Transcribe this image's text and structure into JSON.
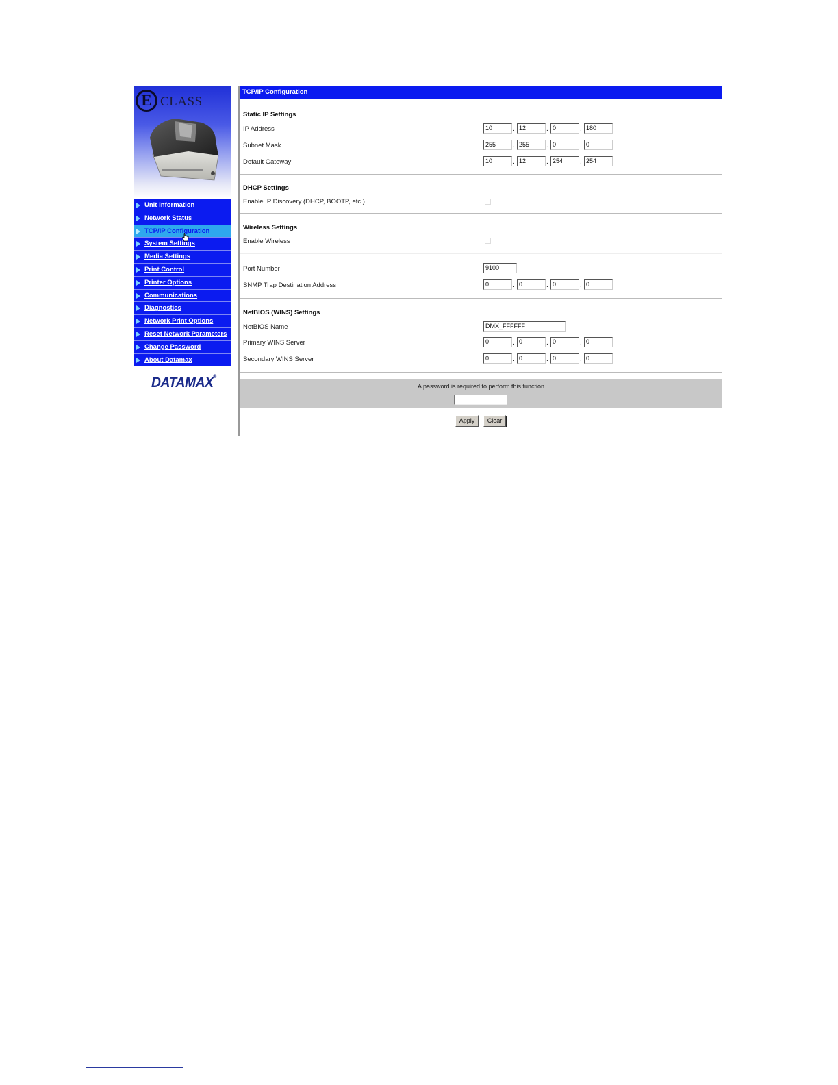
{
  "sidebar": {
    "logo_letter": "E",
    "logo_text": "CLASS",
    "menu": [
      {
        "label": "Unit Information",
        "active": false
      },
      {
        "label": "Network Status",
        "active": false
      },
      {
        "label": "TCP/IP Configuration",
        "active": true
      },
      {
        "label": "System Settings",
        "active": false
      },
      {
        "label": "Media Settings",
        "active": false
      },
      {
        "label": "Print Control",
        "active": false
      },
      {
        "label": "Printer Options",
        "active": false
      },
      {
        "label": "Communications",
        "active": false
      },
      {
        "label": "Diagnostics",
        "active": false
      },
      {
        "label": "Network Print Options",
        "active": false
      },
      {
        "label": "Reset Network Parameters",
        "active": false
      },
      {
        "label": "Change Password",
        "active": false
      },
      {
        "label": "About Datamax",
        "active": false
      }
    ],
    "brand": "DATAMAX",
    "brand_mark": "®"
  },
  "main": {
    "title": "TCP/IP Configuration",
    "static_ip": {
      "heading": "Static IP Settings",
      "ip_address": {
        "label": "IP Address",
        "octets": [
          "10",
          "12",
          "0",
          "180"
        ]
      },
      "subnet_mask": {
        "label": "Subnet Mask",
        "octets": [
          "255",
          "255",
          "0",
          "0"
        ]
      },
      "default_gateway": {
        "label": "Default Gateway",
        "octets": [
          "10",
          "12",
          "254",
          "254"
        ]
      }
    },
    "dhcp": {
      "heading": "DHCP Settings",
      "enable_label": "Enable IP Discovery (DHCP, BOOTP, etc.)",
      "checked": false
    },
    "wireless": {
      "heading": "Wireless Settings",
      "enable_label": "Enable Wireless",
      "checked": false
    },
    "port": {
      "label": "Port Number",
      "value": "9100"
    },
    "snmp": {
      "label": "SNMP Trap Destination Address",
      "octets": [
        "0",
        "0",
        "0",
        "0"
      ]
    },
    "netbios": {
      "heading": "NetBIOS (WINS) Settings",
      "name_label": "NetBIOS Name",
      "name_value": "DMX_FFFFFF",
      "primary_wins": {
        "label": "Primary WINS Server",
        "octets": [
          "0",
          "0",
          "0",
          "0"
        ]
      },
      "secondary_wins": {
        "label": "Secondary WINS Server",
        "octets": [
          "0",
          "0",
          "0",
          "0"
        ]
      }
    },
    "password_prompt": "A password is required to perform this function",
    "password_value": "",
    "apply_label": "Apply",
    "clear_label": "Clear"
  },
  "colors": {
    "menu_blue": "#0b1bf0",
    "menu_active": "#2ea8ee",
    "password_band": "#c8c8c8"
  },
  "icons": {
    "menu_bullet": "triangle-right-icon",
    "cursor": "hand-pointer-icon"
  }
}
